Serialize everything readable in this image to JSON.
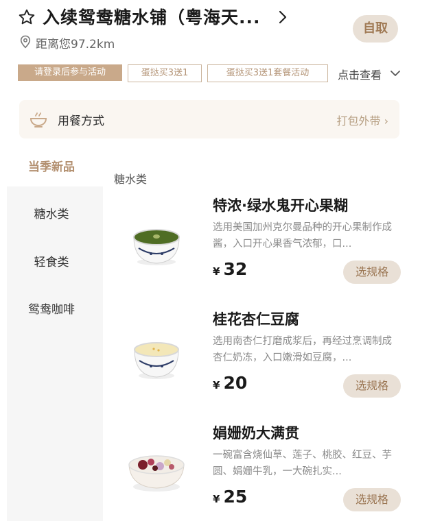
{
  "header": {
    "store_name": "入续鸳鸯糖水铺（粤海天...",
    "distance": "距离您97.2km",
    "pickup_label": "自取",
    "star_icon": "star-outline-icon",
    "pin_icon": "location-pin-icon"
  },
  "promos": {
    "login_tag": "请登录后参与活动",
    "tags": [
      "蛋挞买3送1",
      "蛋挞买3送1套餐活动"
    ],
    "more_label": "点击查看"
  },
  "dining": {
    "label": "用餐方式",
    "option": "打包外带"
  },
  "sidebar": {
    "items": [
      {
        "label": "当季新品",
        "active": true
      },
      {
        "label": "糖水类",
        "active": false
      },
      {
        "label": "轻食类",
        "active": false
      },
      {
        "label": "鸳鸯咖啡",
        "active": false
      }
    ]
  },
  "section": {
    "title": "糖水类"
  },
  "products": [
    {
      "name": "特浓·绿水鬼开心果糊",
      "desc": "选用美国加州克尔曼品种的开心果制作成酱，入口开心果香气浓郁，口...",
      "price_symbol": "¥",
      "price": "32",
      "button": "选规格"
    },
    {
      "name": "桂花杏仁豆腐",
      "desc": "选用南杏仁打磨成浆后，再经过烹调制成杏仁奶冻，入口嫩滑如豆腐，...",
      "price_symbol": "¥",
      "price": "20",
      "button": "选规格"
    },
    {
      "name": "娟姗奶大满贯",
      "desc": "一碗富含烧仙草、莲子、桃胶、红豆、芋圆、娟姗牛乳，一大碗扎实...",
      "price_symbol": "¥",
      "price": "25",
      "button": "选规格"
    }
  ],
  "colors": {
    "accent": "#c9a98a",
    "button_bg": "#e9e0d6",
    "button_text": "#9a7552"
  }
}
